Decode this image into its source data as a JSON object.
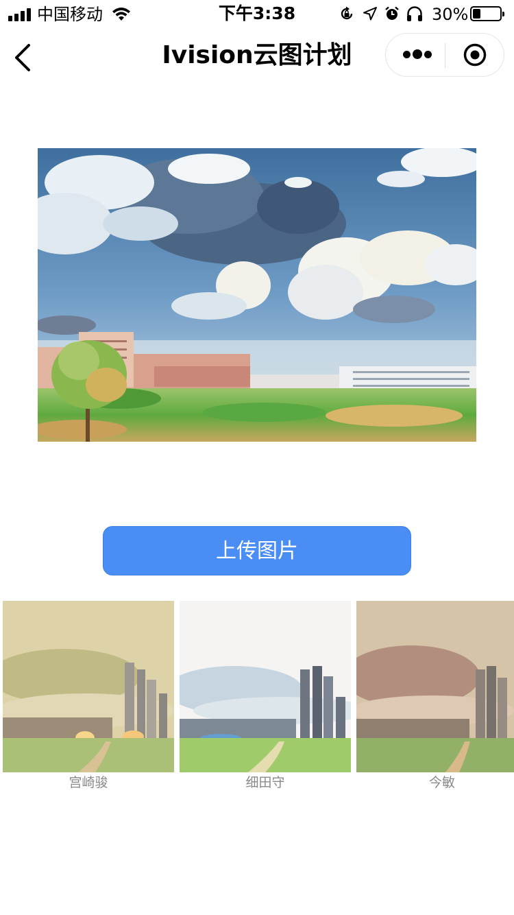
{
  "status_bar": {
    "carrier": "中国移动",
    "time": "下午3:38",
    "battery_percent": "30%",
    "battery_level": 0.3,
    "icons": [
      "signal-icon",
      "wifi-icon",
      "orientation-lock-icon",
      "location-icon",
      "alarm-icon",
      "headphones-icon",
      "battery-icon"
    ]
  },
  "nav": {
    "title": "Ivision云图计划",
    "icons": [
      "back-icon",
      "more-icon",
      "close-target-icon"
    ]
  },
  "main": {
    "image_subject": "anime-style campus scene with clouds",
    "upload_label": "上传图片"
  },
  "styles": {
    "items": [
      {
        "label": "宫崎骏"
      },
      {
        "label": "细田守"
      },
      {
        "label": "今敏"
      }
    ]
  },
  "colors": {
    "accent": "#4a8ef5",
    "caption": "#888888"
  }
}
